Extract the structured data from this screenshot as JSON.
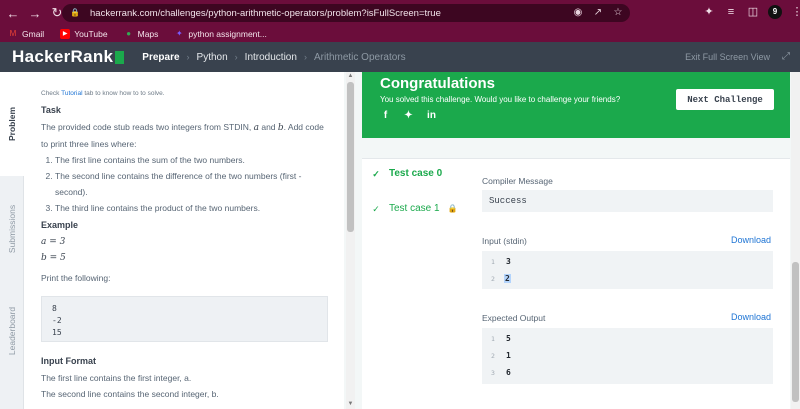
{
  "browser": {
    "url": "hackerrank.com/challenges/python-arithmetic-operators/problem?isFullScreen=true",
    "profile_initial": "9",
    "bookmarks": [
      {
        "label": "Gmail",
        "icon": "gmail-icon",
        "color": "#ea4335"
      },
      {
        "label": "YouTube",
        "icon": "youtube-icon",
        "color": "#ff0000"
      },
      {
        "label": "Maps",
        "icon": "maps-icon",
        "color": "#34a853"
      },
      {
        "label": "python assignment...",
        "icon": "bookmark-icon",
        "color": "#7b5cff"
      }
    ]
  },
  "header": {
    "logo": "HackerRank",
    "crumbs": [
      "Prepare",
      "Python",
      "Introduction",
      "Arithmetic Operators"
    ],
    "exit_fullscreen": "Exit Full Screen View"
  },
  "tabs": [
    "Problem",
    "Submissions",
    "Leaderboard"
  ],
  "problem": {
    "hint_prefix": "Check ",
    "hint_link": "Tutorial",
    "hint_suffix": " tab to know how to to solve.",
    "task_heading": "Task",
    "task_text_1": "The provided code stub reads two integers from STDIN, ",
    "var_a": "a",
    "and": " and ",
    "var_b": "b",
    "task_text_2": ". Add code to print three lines where:",
    "list": [
      "The first line contains the sum of the two numbers.",
      "The second line contains the difference of the two numbers (first - second).",
      "The third line contains the product of the two numbers."
    ],
    "example_heading": "Example",
    "example_a": "a = 3",
    "example_b": "b = 5",
    "print_following": "Print the following:",
    "output_lines": [
      "8",
      "-2",
      "15"
    ],
    "input_format_heading": "Input Format",
    "input_line_1": "The first line contains the first integer, a.",
    "input_line_2": "The second line contains the second integer, b."
  },
  "congrats": {
    "title": "Congratulations",
    "subtitle": "You solved this challenge. Would you like to challenge your friends?",
    "next_button": "Next Challenge",
    "accent": "#1ba94c"
  },
  "results": {
    "test_cases": [
      {
        "label": "Test case 0",
        "locked": false
      },
      {
        "label": "Test case 1",
        "locked": true
      }
    ],
    "compiler_label": "Compiler Message",
    "compiler_message": "Success",
    "input_label": "Input (stdin)",
    "download": "Download",
    "input_lines": [
      {
        "n": "1",
        "v": "3"
      },
      {
        "n": "2",
        "v": "2"
      }
    ],
    "expected_label": "Expected Output",
    "expected_lines": [
      {
        "n": "1",
        "v": "5"
      },
      {
        "n": "2",
        "v": "1"
      },
      {
        "n": "3",
        "v": "6"
      }
    ]
  }
}
